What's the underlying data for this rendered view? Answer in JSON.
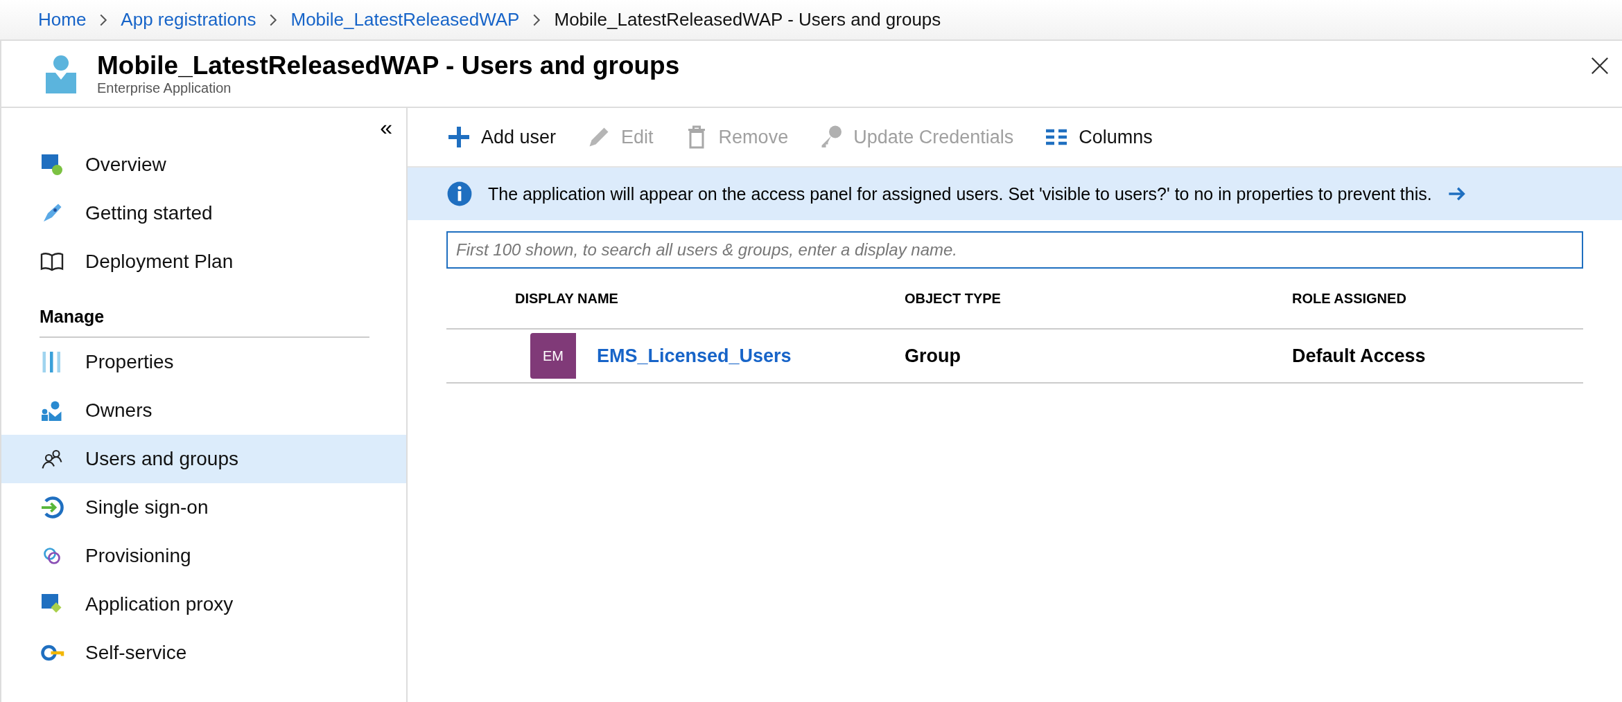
{
  "breadcrumb": [
    {
      "label": "Home",
      "link": true
    },
    {
      "label": "App registrations",
      "link": true
    },
    {
      "label": "Mobile_LatestReleasedWAP",
      "link": true
    },
    {
      "label": "Mobile_LatestReleasedWAP - Users and groups",
      "link": false
    }
  ],
  "header": {
    "title": "Mobile_LatestReleasedWAP - Users and groups",
    "subtitle": "Enterprise Application"
  },
  "sidebar": {
    "collapse": "«",
    "groups": [
      {
        "items": [
          {
            "label": "Overview",
            "selected": false
          },
          {
            "label": "Getting started",
            "selected": false
          },
          {
            "label": "Deployment Plan",
            "selected": false
          }
        ]
      },
      {
        "heading": "Manage",
        "items": [
          {
            "label": "Properties",
            "selected": false
          },
          {
            "label": "Owners",
            "selected": false
          },
          {
            "label": "Users and groups",
            "selected": true
          },
          {
            "label": "Single sign-on",
            "selected": false
          },
          {
            "label": "Provisioning",
            "selected": false
          },
          {
            "label": "Application proxy",
            "selected": false
          },
          {
            "label": "Self-service",
            "selected": false
          }
        ]
      }
    ]
  },
  "toolbar": [
    {
      "label": "Add user",
      "disabled": false
    },
    {
      "label": "Edit",
      "disabled": true
    },
    {
      "label": "Remove",
      "disabled": true
    },
    {
      "label": "Update Credentials",
      "disabled": true
    },
    {
      "label": "Columns",
      "disabled": false
    }
  ],
  "banner": {
    "text": "The application will appear on the access panel for assigned users. Set 'visible to users?' to no in properties to prevent this."
  },
  "search": {
    "placeholder": "First 100 shown, to search all users & groups, enter a display name."
  },
  "table": {
    "columns": [
      "DISPLAY NAME",
      "OBJECT TYPE",
      "ROLE ASSIGNED"
    ],
    "rows": [
      {
        "avatar": "EM",
        "color": "#803a78",
        "name": "EMS_Licensed_Users",
        "type": "Group",
        "role": "Default Access"
      }
    ]
  }
}
